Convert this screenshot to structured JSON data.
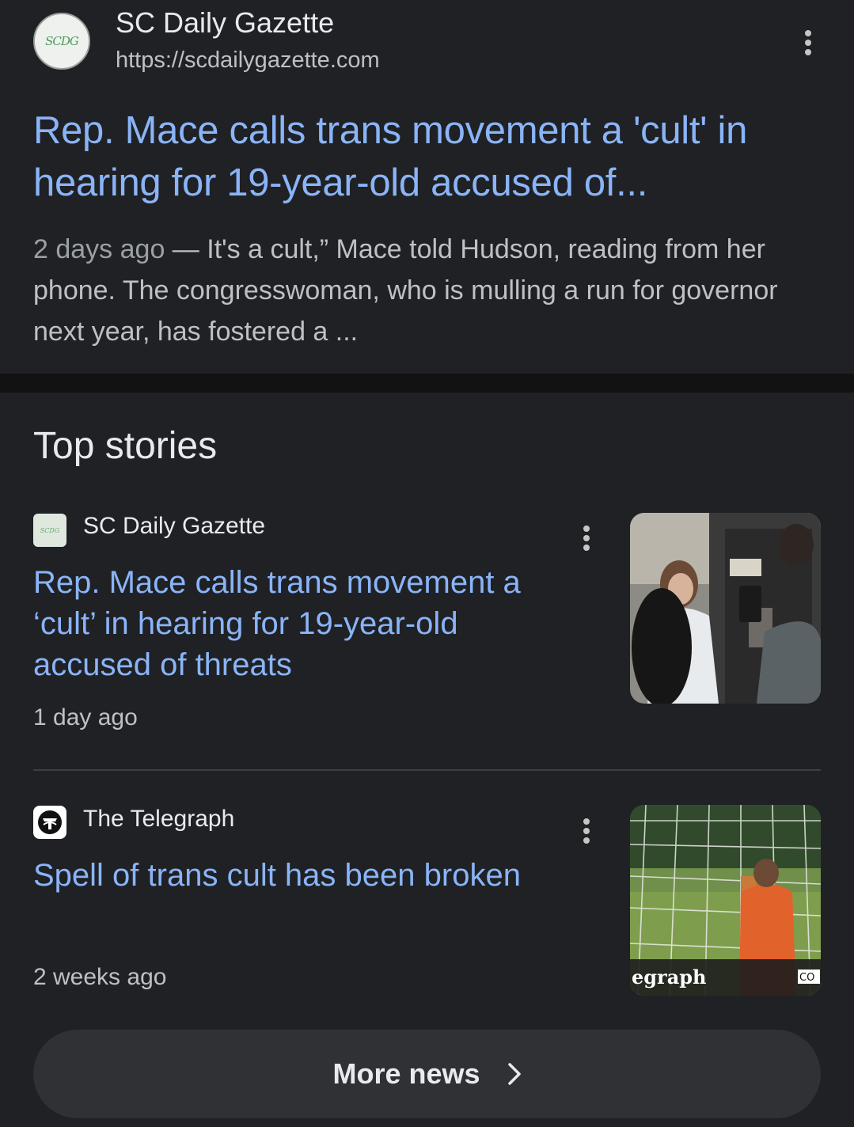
{
  "result": {
    "site_name": "SC Daily Gazette",
    "url": "https://scdailygazette.com",
    "logo_text": "SCDG",
    "title": "Rep. Mace calls trans movement a 'cult' in hearing for 19-year-old accused of...",
    "snippet_date": "2 days ago",
    "snippet_text": " — It's a cult,” Mace told Hudson, reading from her phone. The congresswoman, who is mulling a run for governor next year, has fostered a ..."
  },
  "top_stories": {
    "heading": "Top stories",
    "items": [
      {
        "source": "SC Daily Gazette",
        "logo_text": "SCDG",
        "title": "Rep. Mace calls trans movement a ‘cult’ in hearing for 19-year-old accused of threats",
        "time": "1 day ago"
      },
      {
        "source": "The Telegraph",
        "title": "Spell of trans cult has been broken",
        "time": "2 weeks ago",
        "thumb_caption": "egraph",
        "thumb_badge": "CO"
      }
    ]
  },
  "more_news": {
    "label": "More news"
  },
  "colors": {
    "background": "#202124",
    "link": "#8ab4f8",
    "text": "#e8eaed",
    "muted": "#bdc1c6"
  },
  "icons": [
    "more-vert-icon",
    "chevron-right-icon",
    "telegraph-logo-icon"
  ]
}
